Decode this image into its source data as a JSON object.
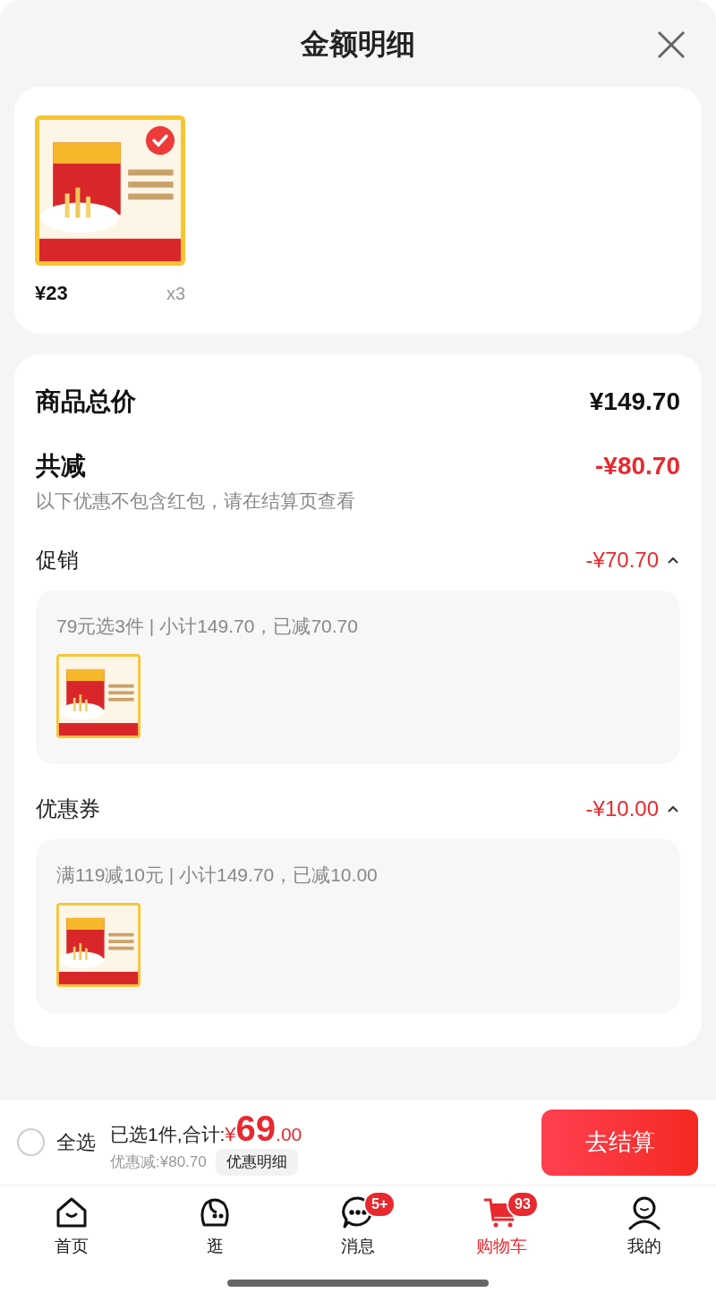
{
  "sheet": {
    "title": "金额明细"
  },
  "items": [
    {
      "kind": "picture",
      "selected": true,
      "price": "¥23",
      "quantity": "x3"
    }
  ],
  "summary": {
    "total_label": "商品总价",
    "total": "¥149.70",
    "discount_label": "共减",
    "discount": "-¥80.70",
    "note": "以下优惠不包含红包，请在结算页查看"
  },
  "sections": [
    {
      "label": "促销",
      "amount": "-¥70.70",
      "expanded": true,
      "detail": "79元选3件 | 小计149.70，已减70.70"
    },
    {
      "label": "优惠券",
      "amount": "-¥10.00",
      "expanded": true,
      "detail": "满119减10元 | 小计149.70，已减10.00"
    }
  ],
  "checkout": {
    "select_all": {
      "label": "全选",
      "checked": false
    },
    "selected_count": "已选1件,合计:",
    "currency": "¥",
    "price_int": "69",
    "price_dec": ".00",
    "saved": "优惠减:¥80.70",
    "details_button": "优惠明细",
    "pay_button": "去结算"
  },
  "tabs": [
    {
      "kind": "home",
      "label": "首页",
      "selected": false
    },
    {
      "kind": "browse",
      "label": "逛",
      "selected": false
    },
    {
      "kind": "messages",
      "label": "消息",
      "selected": false,
      "badge": "5+"
    },
    {
      "kind": "cart",
      "label": "购物车",
      "selected": true,
      "badge": "93"
    },
    {
      "kind": "profile",
      "label": "我的",
      "selected": false
    }
  ]
}
